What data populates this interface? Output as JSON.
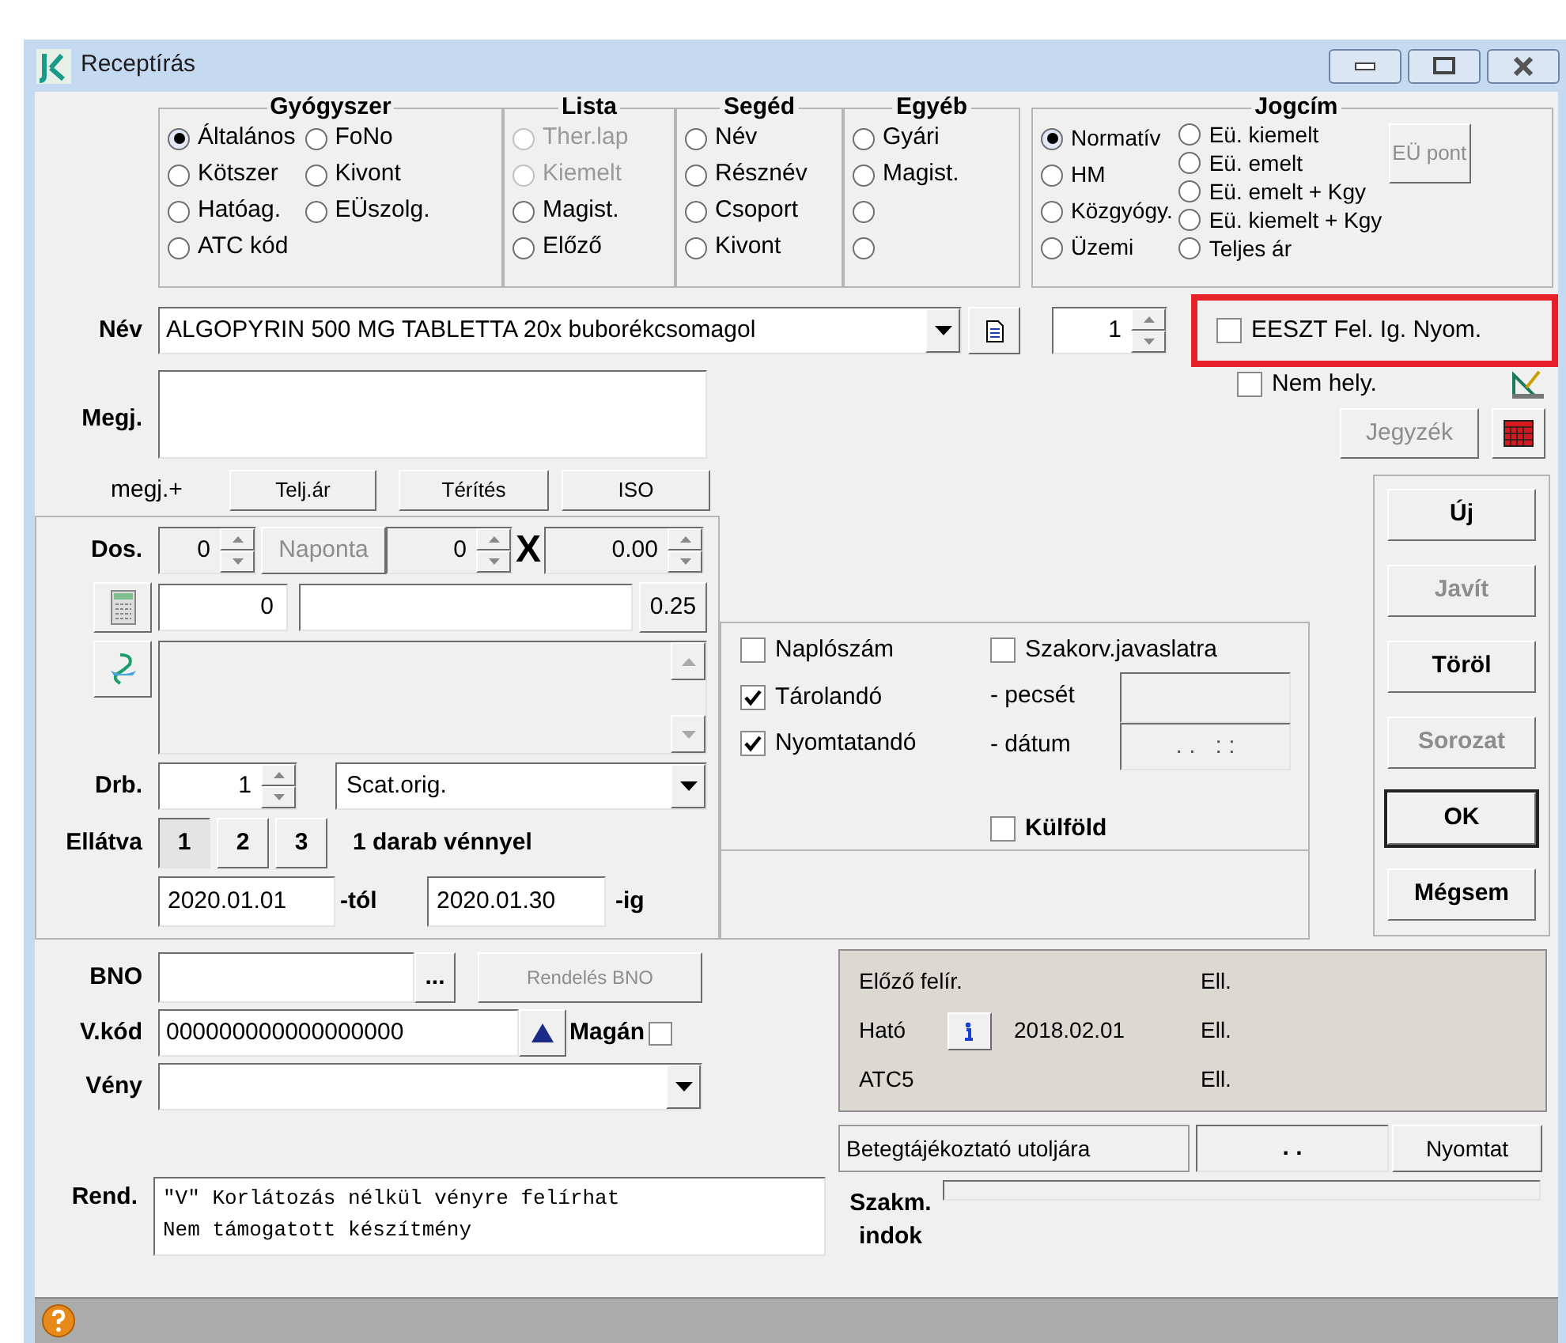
{
  "window": {
    "title": "Receptírás"
  },
  "groups": [
    {
      "title": "Gyógyszer",
      "columns": [
        [
          {
            "label": "Általános",
            "selected": true,
            "disabled": false
          },
          {
            "label": "Kötszer",
            "selected": false,
            "disabled": false
          },
          {
            "label": "Hatóag.",
            "selected": false,
            "disabled": false
          },
          {
            "label": "ATC kód",
            "selected": false,
            "disabled": false
          }
        ],
        [
          {
            "label": "FoNo",
            "selected": false,
            "disabled": false
          },
          {
            "label": "Kivont",
            "selected": false,
            "disabled": false
          },
          {
            "label": "EÜszolg.",
            "selected": false,
            "disabled": false
          }
        ]
      ]
    },
    {
      "title": "Lista",
      "columns": [
        [
          {
            "label": "Ther.lap",
            "selected": false,
            "disabled": true
          },
          {
            "label": "Kiemelt",
            "selected": false,
            "disabled": true
          },
          {
            "label": "Magist.",
            "selected": false,
            "disabled": false
          },
          {
            "label": "Előző",
            "selected": false,
            "disabled": false
          }
        ]
      ]
    },
    {
      "title": "Segéd",
      "columns": [
        [
          {
            "label": "Név",
            "selected": false,
            "disabled": false
          },
          {
            "label": "Résznév",
            "selected": false,
            "disabled": false
          },
          {
            "label": "Csoport",
            "selected": false,
            "disabled": false
          },
          {
            "label": "Kivont",
            "selected": false,
            "disabled": false
          }
        ]
      ]
    },
    {
      "title": "Egyéb",
      "columns": [
        [
          {
            "label": "Gyári",
            "selected": false,
            "disabled": false
          },
          {
            "label": "Magist.",
            "selected": false,
            "disabled": false
          },
          {
            "selected": false,
            "disabled": false
          },
          {
            "selected": false,
            "disabled": false
          }
        ]
      ]
    }
  ],
  "jogcim": {
    "title": "Jogcím",
    "columns": [
      [
        {
          "label": "Normatív",
          "selected": true,
          "disabled": false
        },
        {
          "label": "HM",
          "selected": false,
          "disabled": false
        },
        {
          "label": "Közgyógy.",
          "selected": false,
          "disabled": false
        },
        {
          "label": "Üzemi",
          "selected": false,
          "disabled": false
        }
      ],
      [
        {
          "label": "Eü. kiemelt",
          "selected": false,
          "disabled": false
        },
        {
          "label": "Eü. emelt",
          "selected": false,
          "disabled": false
        },
        {
          "label": "Eü. emelt + Kgy",
          "selected": false,
          "disabled": false
        },
        {
          "label": "Eü. kiemelt + Kgy",
          "selected": false,
          "disabled": false
        },
        {
          "label": "Teljes ár",
          "selected": false,
          "disabled": false
        }
      ]
    ],
    "button": {
      "label": "EÜ pont",
      "disabled": true
    }
  },
  "nev": {
    "label": "Név",
    "value": "ALGOPYRIN 500 MG TABLETTA 20x buborékcsomagol",
    "quantity": "1"
  },
  "eeszt": {
    "label": "EESZT Fel. Ig. Nyom.",
    "checked": false
  },
  "megj": {
    "label": "Megj."
  },
  "nem_hely": {
    "label": "Nem hely.",
    "checked": false
  },
  "jegyzek": {
    "label": "Jegyzék",
    "disabled": true
  },
  "megj_plus": "megj.+",
  "price_buttons": [
    "Telj.ár",
    "Térítés",
    "ISO"
  ],
  "dos": {
    "label": "Dos.",
    "count": "0",
    "period": {
      "label": "Naponta",
      "disabled": true
    },
    "amount": "0",
    "times": "X",
    "dose": "0.00",
    "total": "0",
    "unit_button": "0.25"
  },
  "drb": {
    "label": "Drb.",
    "count": "1",
    "package": "Scat.orig."
  },
  "ellatva": {
    "label": "Ellátva",
    "tabs": [
      {
        "label": "1",
        "selected": true
      },
      {
        "label": "2",
        "selected": false
      },
      {
        "label": "3",
        "selected": false
      }
    ],
    "summary": "1 darab vénnyel",
    "from": "2020.01.01",
    "from_suffix": "-tól",
    "to": "2020.01.30",
    "to_suffix": "-ig"
  },
  "options": {
    "left": [
      {
        "label": "Naplószám",
        "checked": false
      },
      {
        "label": "Tárolandó",
        "checked": true
      },
      {
        "label": "Nyomtatandó",
        "checked": true
      }
    ],
    "specialist": {
      "label": "Szakorv.javaslatra",
      "checked": false
    },
    "stamp_label": "- pecsét",
    "date_label": "- dátum",
    "date_value": ". .   : :",
    "abroad": {
      "label": "Külföld",
      "checked": false
    }
  },
  "actions": [
    {
      "label": "Új",
      "disabled": false,
      "default": false
    },
    {
      "label": "Javít",
      "disabled": true,
      "default": false
    },
    {
      "label": "Töröl",
      "disabled": false,
      "default": false
    },
    {
      "label": "Sorozat",
      "disabled": true,
      "default": false
    },
    {
      "label": "OK",
      "disabled": false,
      "default": true
    },
    {
      "label": "Mégsem",
      "disabled": false,
      "default": false
    }
  ],
  "bno": {
    "label": "BNO",
    "browse": "...",
    "order": {
      "label": "Rendelés BNO",
      "disabled": true
    }
  },
  "vkod": {
    "label": "V.kód",
    "value": "000000000000000000",
    "private": {
      "label": "Magán",
      "checked": false
    }
  },
  "veny": {
    "label": "Vény"
  },
  "rend": {
    "label": "Rend.",
    "lines": [
      "\"V\" Korlátozás nélkül vényre felírhat",
      "Nem támogatott készítmény"
    ]
  },
  "history": {
    "rows": [
      {
        "kind": "plain",
        "label": "Előző felír.",
        "status": "Ell."
      },
      {
        "kind": "info",
        "label": "Ható",
        "date": "2018.02.01",
        "status": "Ell."
      },
      {
        "kind": "plain",
        "label": "ATC5",
        "status": "Ell."
      }
    ]
  },
  "leaflet": {
    "label": "Betegtájékoztató utoljára",
    "value": ". .",
    "button": "Nyomtat"
  },
  "szakm": {
    "label": "Szakm. indok"
  }
}
